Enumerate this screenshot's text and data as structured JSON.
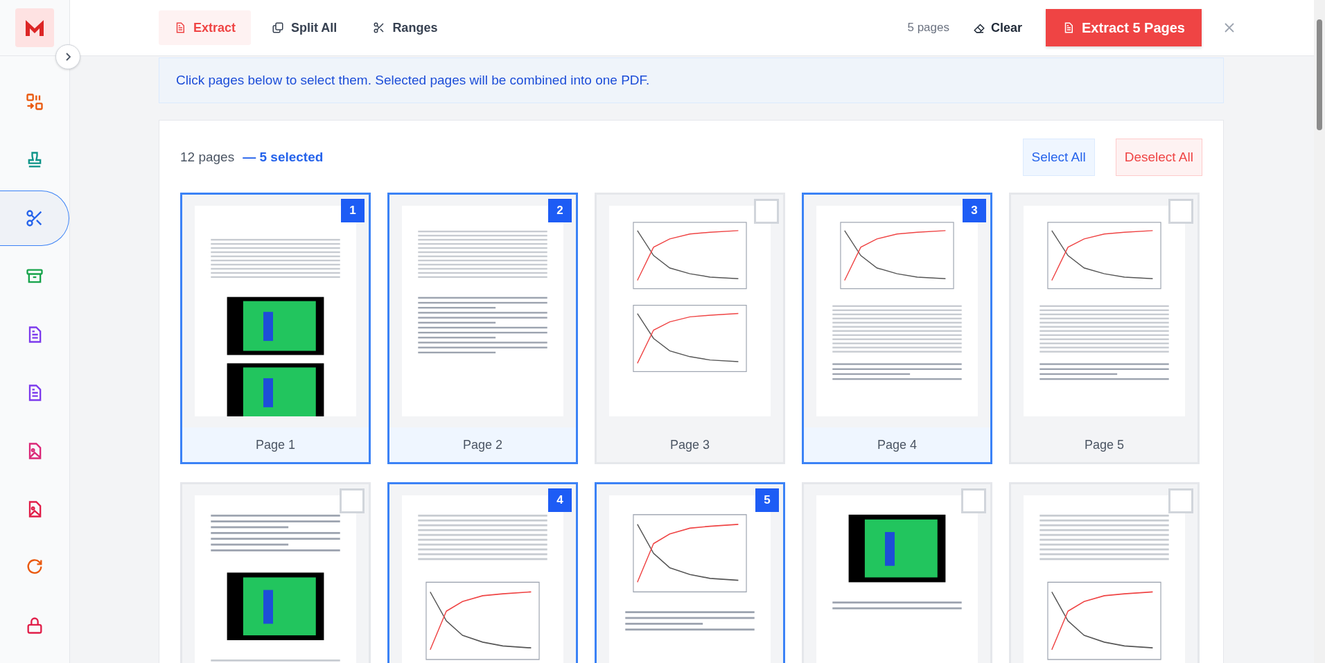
{
  "sidebar": {
    "items": [
      {
        "kind": "organize",
        "selected": false,
        "color": "#ea580c"
      },
      {
        "kind": "stamp",
        "selected": false,
        "color": "#0d9488"
      },
      {
        "kind": "scissors",
        "selected": true,
        "color": "#2563eb"
      },
      {
        "kind": "archive",
        "selected": false,
        "color": "#16a34a"
      },
      {
        "kind": "document",
        "selected": false,
        "color": "#7c3aed"
      },
      {
        "kind": "document",
        "selected": false,
        "color": "#7c3aed"
      },
      {
        "kind": "image-file",
        "selected": false,
        "color": "#db2777"
      },
      {
        "kind": "image-file",
        "selected": false,
        "color": "#e11d48"
      },
      {
        "kind": "rotate",
        "selected": false,
        "color": "#ea580c"
      },
      {
        "kind": "lock",
        "selected": false,
        "color": "#e11d48"
      }
    ]
  },
  "toolbar": {
    "modes": [
      {
        "label": "Extract",
        "kind": "document",
        "selected": true
      },
      {
        "label": "Split All",
        "kind": "copy",
        "selected": false
      },
      {
        "label": "Ranges",
        "kind": "scissors",
        "selected": false
      }
    ],
    "count": "5 pages",
    "clear": "Clear",
    "primary": "Extract 5 Pages"
  },
  "banner": "Click pages below to select them. Selected pages will be combined into one PDF.",
  "grid": {
    "total": "12 pages",
    "selected_count": "— 5 selected",
    "select_all": "Select All",
    "deselect_all": "Deselect All",
    "pages": [
      {
        "label": "Page 1",
        "selected": true,
        "order": "1",
        "kind": "table-photo"
      },
      {
        "label": "Page 2",
        "selected": true,
        "order": "2",
        "kind": "table-text"
      },
      {
        "label": "Page 3",
        "selected": false,
        "kind": "charts"
      },
      {
        "label": "Page 4",
        "selected": true,
        "order": "3",
        "kind": "chart-table"
      },
      {
        "label": "Page 5",
        "selected": false,
        "kind": "chart-table"
      },
      {
        "selected": false,
        "kind": "photo-text"
      },
      {
        "selected": true,
        "order": "4",
        "kind": "table-chart"
      },
      {
        "selected": true,
        "order": "5",
        "kind": "chart-text"
      },
      {
        "selected": false,
        "kind": "photo"
      },
      {
        "selected": false,
        "kind": "table-chart"
      }
    ]
  }
}
